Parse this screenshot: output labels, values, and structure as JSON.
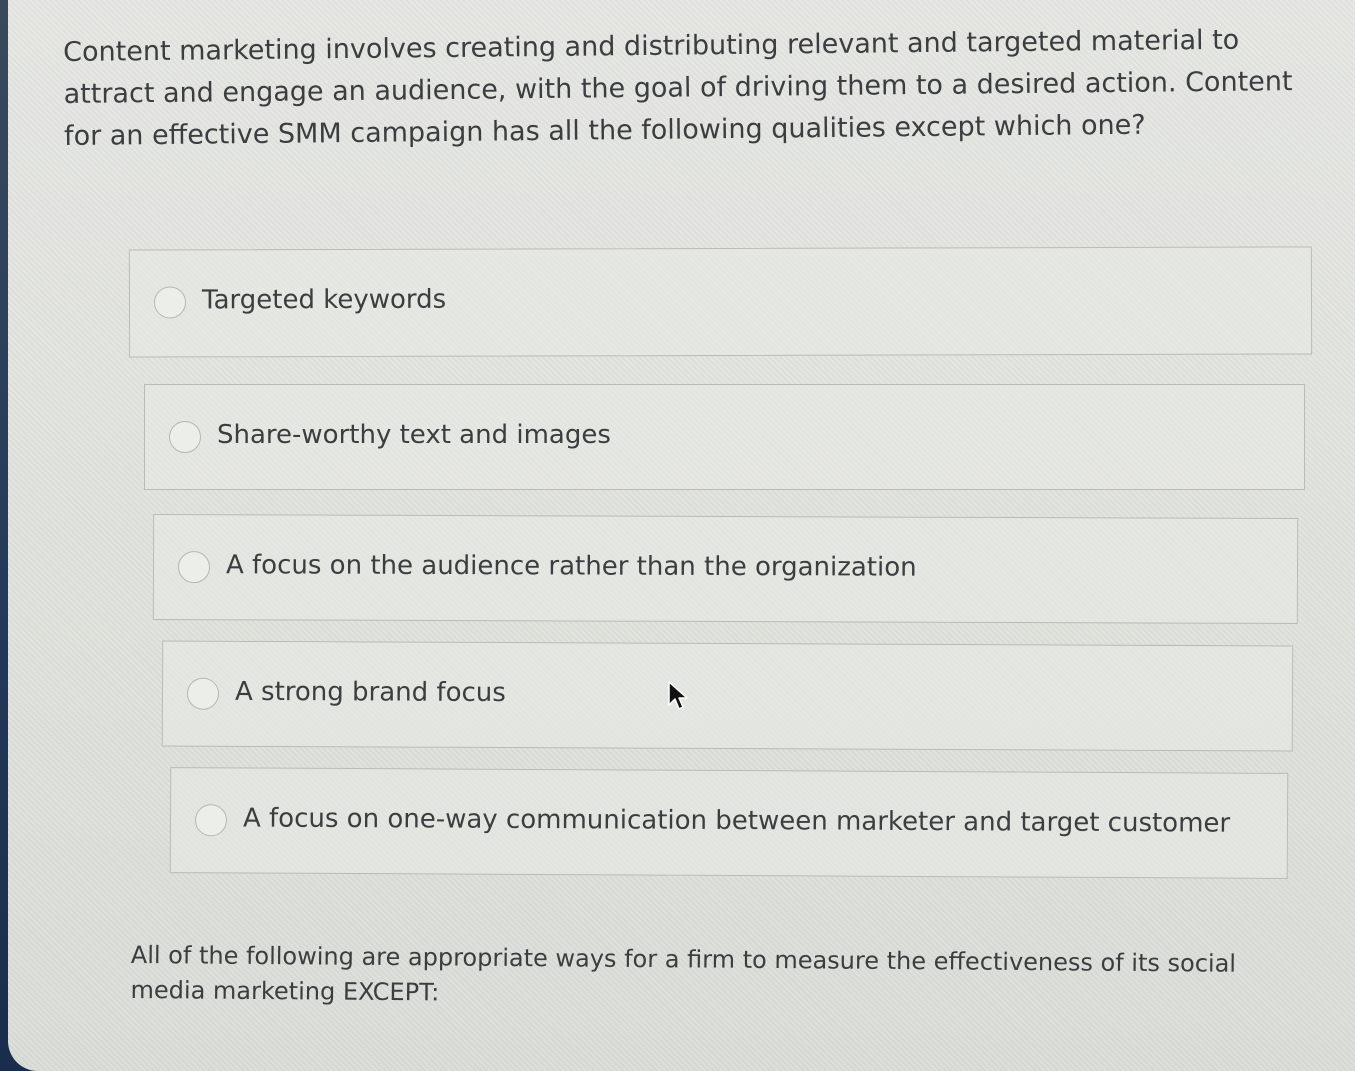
{
  "question1": {
    "text": "Content marketing involves creating and distributing relevant and targeted material to attract and engage an audience, with the goal of driving them to a desired action. Content for an effective SMM campaign has all the following qualities except which one?",
    "options": [
      {
        "label": "Targeted keywords",
        "selected": false
      },
      {
        "label": "Share-worthy text and images",
        "selected": false
      },
      {
        "label": "A focus on the audience rather than the organization",
        "selected": false
      },
      {
        "label": "A strong brand focus",
        "selected": false
      },
      {
        "label": "A focus on one-way communication between marketer and target customer",
        "selected": false
      }
    ]
  },
  "question2": {
    "text": "All of the following are appropriate ways for a firm to measure the effectiveness of its social media marketing EXCEPT:"
  },
  "icons": {
    "radio": "radio-empty-icon",
    "cursor": "mouse-pointer-icon"
  }
}
